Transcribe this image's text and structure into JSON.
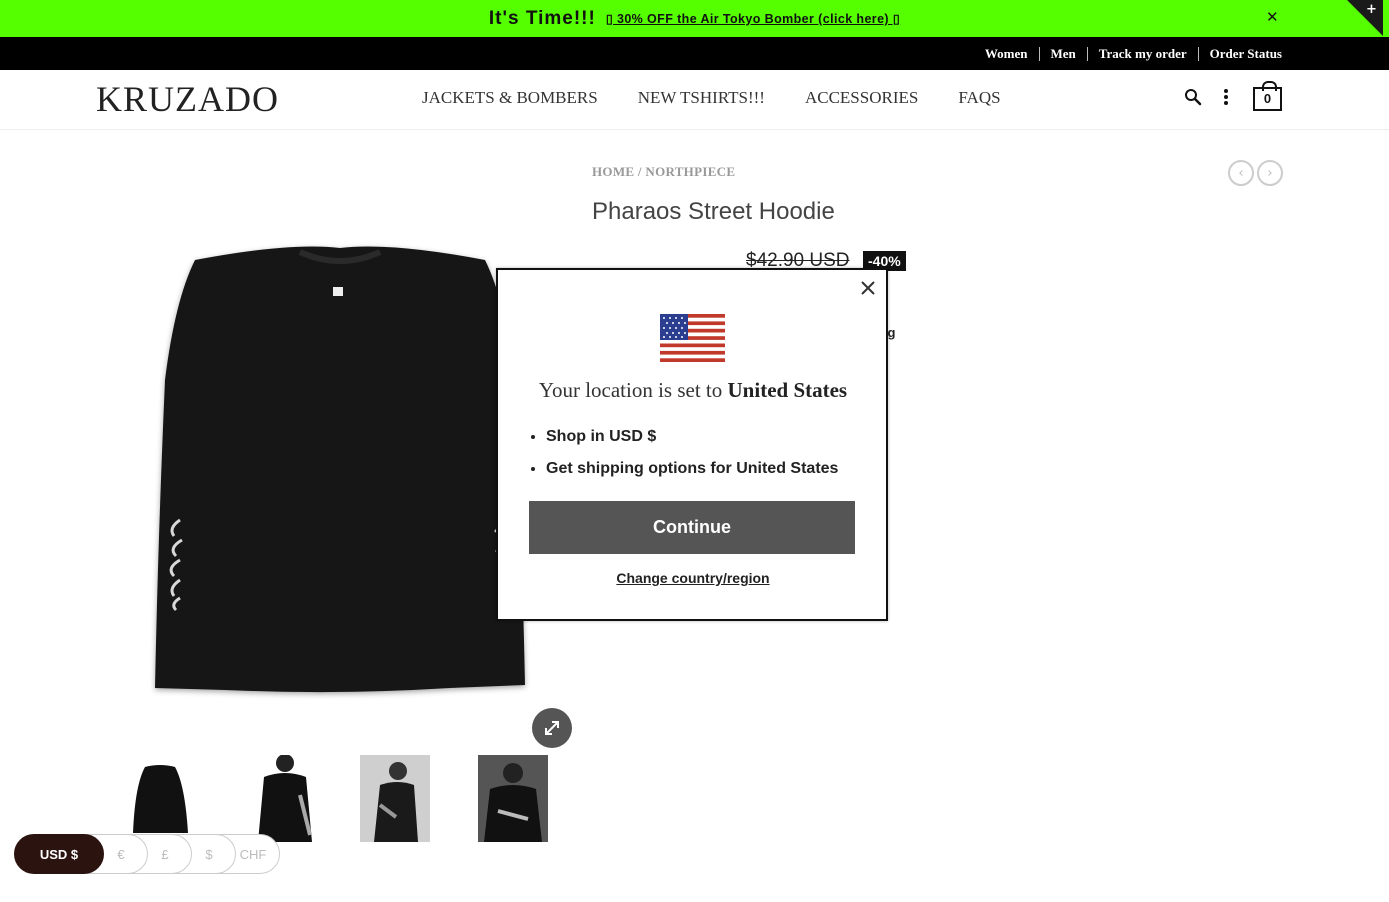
{
  "announcement": {
    "headline": "It's Time!!!",
    "promo": "▯ 30% OFF the Air Tokyo Bomber (click here) ▯",
    "close": "✕",
    "corner": "+"
  },
  "topbar": {
    "links": [
      "Women",
      "Men",
      "Track my order",
      "Order Status"
    ]
  },
  "header": {
    "logo": "KRUZADO",
    "nav": [
      "JACKETS & BOMBERS",
      "NEW TSHIRTS!!!",
      "ACCESSORIES",
      "FAQS"
    ],
    "cart_count": "0"
  },
  "product": {
    "breadcrumb": "HOME / NORTHPIECE",
    "title": "Pharaos Street Hoodie",
    "old_price": "$42.90 USD",
    "discount": "-40%",
    "partial_text": "ping",
    "prev_icon": "‹",
    "next_icon": "›"
  },
  "modal": {
    "title_prefix": "Your location is set to ",
    "title_country": "United States",
    "bullets": [
      "Shop in USD $",
      "Get shipping options for United States"
    ],
    "continue_label": "Continue",
    "change_label": "Change country/region"
  },
  "currency": {
    "options": [
      "USD $",
      "€",
      "£",
      "$",
      "CHF"
    ],
    "selected": "USD $"
  },
  "colors": {
    "announce_bg": "#55ff00",
    "continue_bg": "#555555",
    "currency_active": "#2b1310"
  }
}
